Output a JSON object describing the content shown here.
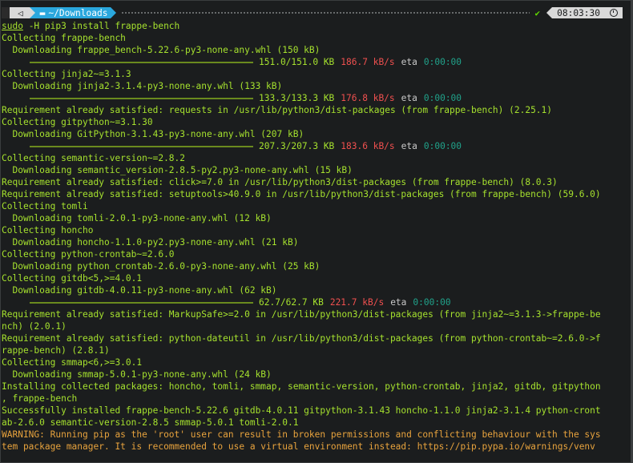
{
  "prompt": {
    "directory": "~/Downloads",
    "status_icon": "checkmark",
    "time": "08:03:30"
  },
  "command": {
    "sudo": "sudo",
    "rest": " -H pip3 install frappe-bench"
  },
  "lines": [
    {
      "type": "text",
      "text": "Collecting frappe-bench"
    },
    {
      "type": "text",
      "text": "  Downloading frappe_bench-5.22.6-py3-none-any.whl (150 kB)"
    },
    {
      "type": "progress",
      "size": "151.0/151.0 KB",
      "speed": "186.7 kB/s",
      "eta_label": "eta",
      "eta": "0:00:00",
      "fraction": 1.0
    },
    {
      "type": "text",
      "text": "Collecting jinja2~=3.1.3"
    },
    {
      "type": "text",
      "text": "  Downloading jinja2-3.1.4-py3-none-any.whl (133 kB)"
    },
    {
      "type": "progress",
      "size": "133.3/133.3 KB",
      "speed": "176.8 kB/s",
      "eta_label": "eta",
      "eta": "0:00:00",
      "fraction": 1.0
    },
    {
      "type": "text",
      "text": "Requirement already satisfied: requests in /usr/lib/python3/dist-packages (from frappe-bench) (2.25.1)"
    },
    {
      "type": "text",
      "text": "Collecting gitpython~=3.1.30"
    },
    {
      "type": "text",
      "text": "  Downloading GitPython-3.1.43-py3-none-any.whl (207 kB)"
    },
    {
      "type": "progress",
      "size": "207.3/207.3 KB",
      "speed": "183.6 kB/s",
      "eta_label": "eta",
      "eta": "0:00:00",
      "fraction": 1.0
    },
    {
      "type": "text",
      "text": "Collecting semantic-version~=2.8.2"
    },
    {
      "type": "text",
      "text": "  Downloading semantic_version-2.8.5-py2.py3-none-any.whl (15 kB)"
    },
    {
      "type": "text",
      "text": "Requirement already satisfied: click>=7.0 in /usr/lib/python3/dist-packages (from frappe-bench) (8.0.3)"
    },
    {
      "type": "text",
      "text": "Requirement already satisfied: setuptools>40.9.0 in /usr/lib/python3/dist-packages (from frappe-bench) (59.6.0)"
    },
    {
      "type": "text",
      "text": "Collecting tomli"
    },
    {
      "type": "text",
      "text": "  Downloading tomli-2.0.1-py3-none-any.whl (12 kB)"
    },
    {
      "type": "text",
      "text": "Collecting honcho"
    },
    {
      "type": "text",
      "text": "  Downloading honcho-1.1.0-py2.py3-none-any.whl (21 kB)"
    },
    {
      "type": "text",
      "text": "Collecting python-crontab~=2.6.0"
    },
    {
      "type": "text",
      "text": "  Downloading python_crontab-2.6.0-py3-none-any.whl (25 kB)"
    },
    {
      "type": "text",
      "text": "Collecting gitdb<5,>=4.0.1"
    },
    {
      "type": "text",
      "text": "  Downloading gitdb-4.0.11-py3-none-any.whl (62 kB)"
    },
    {
      "type": "progress",
      "size": "62.7/62.7 KB",
      "speed": "221.7 kB/s",
      "eta_label": "eta",
      "eta": "0:00:00",
      "fraction": 1.0
    },
    {
      "type": "text",
      "text": "Requirement already satisfied: MarkupSafe>=2.0 in /usr/lib/python3/dist-packages (from jinja2~=3.1.3->frappe-be"
    },
    {
      "type": "text",
      "text": "nch) (2.0.1)"
    },
    {
      "type": "text",
      "text": "Requirement already satisfied: python-dateutil in /usr/lib/python3/dist-packages (from python-crontab~=2.6.0->f"
    },
    {
      "type": "text",
      "text": "rappe-bench) (2.8.1)"
    },
    {
      "type": "text",
      "text": "Collecting smmap<6,>=3.0.1"
    },
    {
      "type": "text",
      "text": "  Downloading smmap-5.0.1-py3-none-any.whl (24 kB)"
    },
    {
      "type": "text",
      "text": "Installing collected packages: honcho, tomli, smmap, semantic-version, python-crontab, jinja2, gitdb, gitpython"
    },
    {
      "type": "text",
      "text": ", frappe-bench"
    },
    {
      "type": "text",
      "text": "Successfully installed frappe-bench-5.22.6 gitdb-4.0.11 gitpython-3.1.43 honcho-1.1.0 jinja2-3.1.4 python-cront"
    },
    {
      "type": "text",
      "text": "ab-2.6.0 semantic-version-2.8.5 smmap-5.0.1 tomli-2.0.1"
    },
    {
      "type": "warning",
      "text": "WARNING: Running pip as the 'root' user can result in broken permissions and conflicting behaviour with the sys"
    },
    {
      "type": "warning",
      "text": "tem package manager. It is recommended to use a virtual environment instead: https://pip.pypa.io/warnings/venv"
    }
  ]
}
